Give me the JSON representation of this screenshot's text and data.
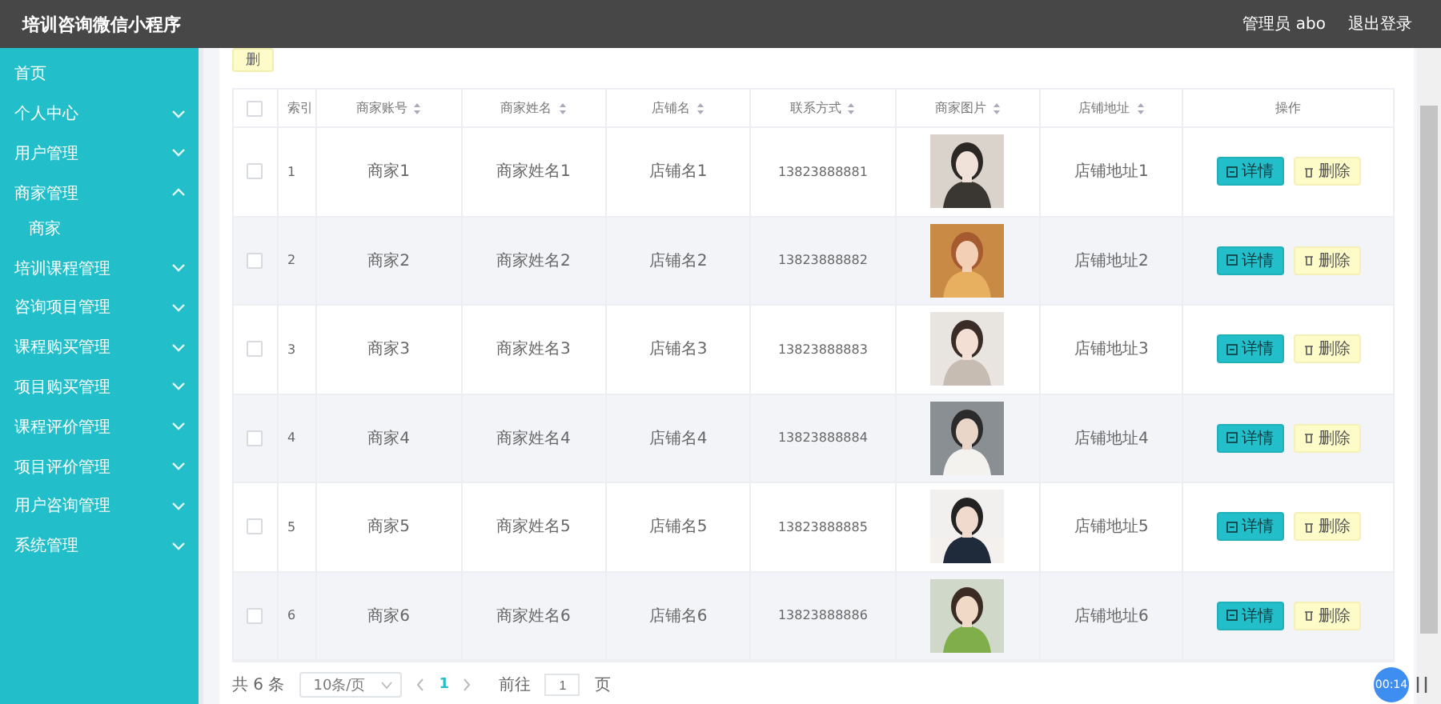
{
  "header": {
    "title": "培训咨询微信小程序",
    "user": "管理员 abo",
    "logout": "退出登录"
  },
  "sidebar": {
    "items": [
      {
        "label": "首页",
        "expandable": false
      },
      {
        "label": "个人中心",
        "expandable": true,
        "expanded": false
      },
      {
        "label": "用户管理",
        "expandable": true,
        "expanded": false
      },
      {
        "label": "商家管理",
        "expandable": true,
        "expanded": true,
        "children": [
          {
            "label": "商家"
          }
        ]
      },
      {
        "label": "培训课程管理",
        "expandable": true,
        "expanded": false
      },
      {
        "label": "咨询项目管理",
        "expandable": true,
        "expanded": false
      },
      {
        "label": "课程购买管理",
        "expandable": true,
        "expanded": false
      },
      {
        "label": "项目购买管理",
        "expandable": true,
        "expanded": false
      },
      {
        "label": "课程评价管理",
        "expandable": true,
        "expanded": false
      },
      {
        "label": "项目评价管理",
        "expandable": true,
        "expanded": false
      },
      {
        "label": "用户咨询管理",
        "expandable": true,
        "expanded": false
      },
      {
        "label": "系统管理",
        "expandable": true,
        "expanded": false
      }
    ]
  },
  "toolbar": {
    "delete_button": "删"
  },
  "table": {
    "header_checked": false,
    "columns": [
      {
        "label": "索引",
        "sortable": false
      },
      {
        "label": "商家账号",
        "sortable": true
      },
      {
        "label": "商家姓名",
        "sortable": true
      },
      {
        "label": "店铺名",
        "sortable": true
      },
      {
        "label": "联系方式",
        "sortable": true
      },
      {
        "label": "商家图片",
        "sortable": true
      },
      {
        "label": "店铺地址",
        "sortable": true
      },
      {
        "label": "操作",
        "sortable": false
      }
    ],
    "rows": [
      {
        "checked": false,
        "index": "1",
        "account": "商家1",
        "name": "商家姓名1",
        "shop": "店铺名1",
        "phone": "13823888881",
        "address": "店铺地址1",
        "actions": [
          "详情",
          "删除"
        ]
      },
      {
        "checked": false,
        "index": "2",
        "account": "商家2",
        "name": "商家姓名2",
        "shop": "店铺名2",
        "phone": "13823888882",
        "address": "店铺地址2",
        "actions": [
          "详情",
          "删除"
        ]
      },
      {
        "checked": false,
        "index": "3",
        "account": "商家3",
        "name": "商家姓名3",
        "shop": "店铺名3",
        "phone": "13823888883",
        "address": "店铺地址3",
        "actions": [
          "详情",
          "删除"
        ]
      },
      {
        "checked": false,
        "index": "4",
        "account": "商家4",
        "name": "商家姓名4",
        "shop": "店铺名4",
        "phone": "13823888884",
        "address": "店铺地址4",
        "actions": [
          "详情",
          "删除"
        ]
      },
      {
        "checked": false,
        "index": "5",
        "account": "商家5",
        "name": "商家姓名5",
        "shop": "店铺名5",
        "phone": "13823888885",
        "address": "店铺地址5",
        "actions": [
          "详情",
          "删除"
        ]
      },
      {
        "checked": false,
        "index": "6",
        "account": "商家6",
        "name": "商家姓名6",
        "shop": "店铺名6",
        "phone": "13823888886",
        "address": "店铺地址6",
        "actions": [
          "详情",
          "删除"
        ]
      }
    ]
  },
  "pagination": {
    "total": "共 6 条",
    "page_size": "10条/页",
    "pages": [
      {
        "label": "1",
        "selected": true
      }
    ],
    "goto_label": "前往",
    "goto_value": "1",
    "goto_suffix": "页"
  },
  "recorder": {
    "time": "00:14"
  }
}
